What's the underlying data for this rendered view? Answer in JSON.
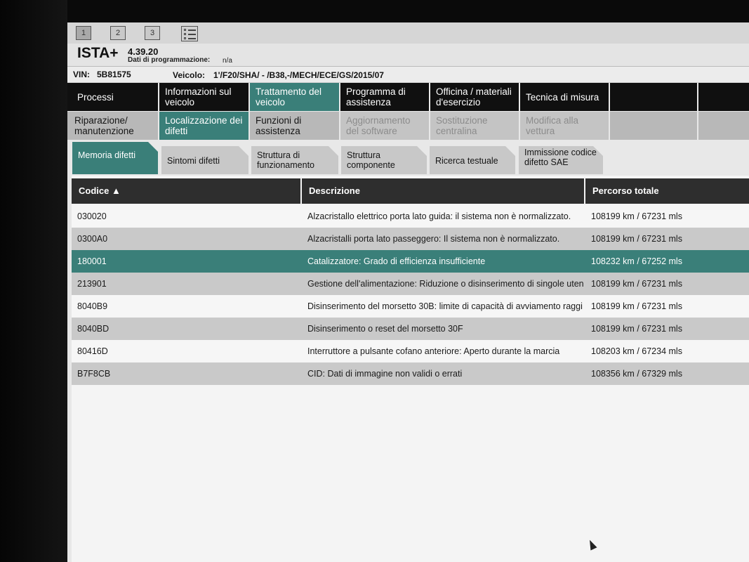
{
  "window_tabs": [
    "1",
    "2",
    "3"
  ],
  "app": {
    "name": "ISTA+",
    "version": "4.39.20",
    "programming_label": "Dati di programmazione:",
    "programming_value": "n/a"
  },
  "vehicle": {
    "vin_label": "VIN:",
    "vin": "5B81575",
    "vehicle_label": "Veicolo:",
    "vehicle_value": "1'/F20/SHA/ - /B38,-/MECH/ECE/GS/2015/07"
  },
  "nav_main": [
    {
      "label": "Processi"
    },
    {
      "label": "Informazioni sul veicolo"
    },
    {
      "label": "Trattamento del veicolo"
    },
    {
      "label": "Programma di assistenza"
    },
    {
      "label": "Officina / materiali d'esercizio"
    },
    {
      "label": "Tecnica di misura"
    },
    {
      "label": ""
    },
    {
      "label": ""
    }
  ],
  "nav_sub": [
    {
      "label": "Riparazione/ manutenzione"
    },
    {
      "label": "Localizzazione dei difetti"
    },
    {
      "label": "Funzioni di assistenza"
    },
    {
      "label": "Aggiornamento del software"
    },
    {
      "label": "Sostituzione centralina"
    },
    {
      "label": "Modifica alla vettura"
    },
    {
      "label": ""
    },
    {
      "label": ""
    }
  ],
  "sub_tabs": [
    {
      "label": "Memoria difetti"
    },
    {
      "label": "Sintomi difetti"
    },
    {
      "label": "Struttura di funzionamento"
    },
    {
      "label": "Struttura componente"
    },
    {
      "label": "Ricerca testuale"
    },
    {
      "label": "Immissione codice difetto SAE"
    }
  ],
  "table": {
    "headers": {
      "code": "Codice ▲",
      "description": "Descrizione",
      "mileage": "Percorso totale"
    },
    "rows": [
      {
        "code": "030020",
        "description": "Alzacristallo elettrico porta lato guida: il sistema non è normalizzato.",
        "mileage": "108199 km / 67231 mls"
      },
      {
        "code": "0300A0",
        "description": "Alzacristalli porta lato passeggero: Il sistema non è normalizzato.",
        "mileage": "108199 km / 67231 mls"
      },
      {
        "code": "180001",
        "description": "Catalizzatore: Grado di efficienza insufficiente",
        "mileage": "108232 km / 67252 mls"
      },
      {
        "code": "213901",
        "description": "Gestione dell'alimentazione: Riduzione o disinserimento di singole uten",
        "mileage": "108199 km / 67231 mls"
      },
      {
        "code": "8040B9",
        "description": "Disinserimento del morsetto 30B: limite di capacità di avviamento raggi",
        "mileage": "108199 km / 67231 mls"
      },
      {
        "code": "8040BD",
        "description": "Disinserimento o reset del morsetto 30F",
        "mileage": "108199 km / 67231 mls"
      },
      {
        "code": "80416D",
        "description": "Interruttore a pulsante cofano anteriore: Aperto durante la marcia",
        "mileage": "108203 km / 67234 mls"
      },
      {
        "code": "B7F8CB",
        "description": "CID: Dati di immagine non validi o errati",
        "mileage": "108356 km / 67329 mls"
      }
    ]
  },
  "colors": {
    "accent": "#3a7f79",
    "nav_dark": "#101010",
    "header_dark": "#2e2e2e"
  },
  "icons": {
    "list_view": "list-view-icon",
    "cursor": "mouse-cursor-icon"
  }
}
